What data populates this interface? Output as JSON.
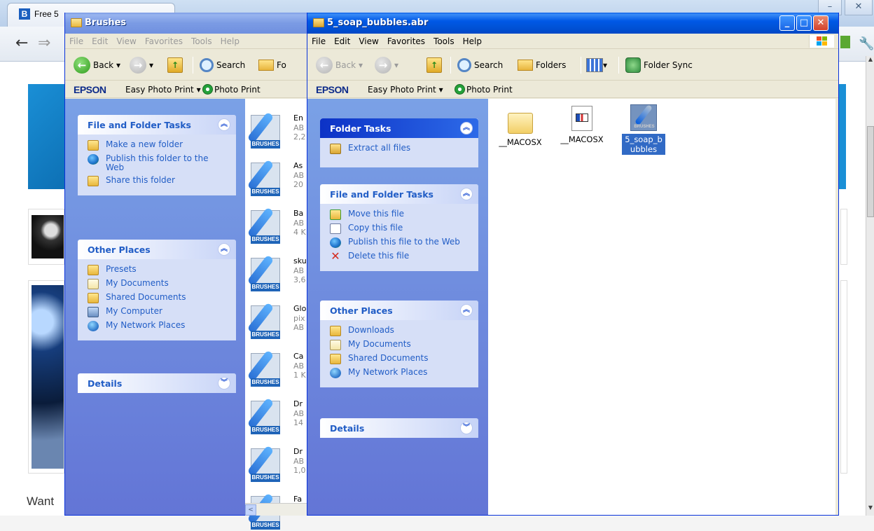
{
  "browser": {
    "tab_title": "Free 5",
    "tab_icon_letter": "B",
    "page_text_want": "Want",
    "win_min": "–",
    "win_close": "✕"
  },
  "brushes_window": {
    "title": "Brushes",
    "menu": [
      "File",
      "Edit",
      "View",
      "Favorites",
      "Tools",
      "Help"
    ],
    "toolbar": {
      "back": "Back",
      "search": "Search",
      "folders_partial": "Fo"
    },
    "epson": {
      "logo": "EPSON",
      "easy_photo": "Easy Photo Print ▾",
      "photo_print": "Photo Print"
    },
    "file_folder_tasks": {
      "title": "File and Folder Tasks",
      "items": [
        {
          "label": "Make a new folder",
          "icon": "folder-new-icon"
        },
        {
          "label": "Publish this folder to the Web",
          "icon": "globe-icon"
        },
        {
          "label": "Share this folder",
          "icon": "share-icon"
        }
      ]
    },
    "other_places": {
      "title": "Other Places",
      "items": [
        {
          "label": "Presets",
          "icon": "folder-icon"
        },
        {
          "label": "My Documents",
          "icon": "documents-icon"
        },
        {
          "label": "Shared Documents",
          "icon": "folder-icon"
        },
        {
          "label": "My Computer",
          "icon": "computer-icon"
        },
        {
          "label": "My Network Places",
          "icon": "network-icon"
        }
      ]
    },
    "details": {
      "title": "Details"
    },
    "brush_files": [
      {
        "name": "En",
        "type": "AB",
        "size": "2,2"
      },
      {
        "name": "As",
        "type": "AB",
        "size": "20"
      },
      {
        "name": "Ba",
        "type": "AB",
        "size": "4 K"
      },
      {
        "name": "sku",
        "type": "AB",
        "size": "3,6"
      },
      {
        "name": "Glo",
        "type": "pix",
        "size": "AB"
      },
      {
        "name": "Ca",
        "type": "AB",
        "size": "1 K"
      },
      {
        "name": "Dr",
        "type": "AB",
        "size": "14"
      },
      {
        "name": "Dr",
        "type": "AB",
        "size": "1,0"
      },
      {
        "name": "Fa",
        "type": "",
        "size": ""
      }
    ],
    "brushes_tag": "BRUSHES",
    "scroll_arrow": "<"
  },
  "soap_window": {
    "title": "5_soap_bubbles.abr",
    "menu": [
      "File",
      "Edit",
      "View",
      "Favorites",
      "Tools",
      "Help"
    ],
    "caption_buttons": {
      "minimize": "_",
      "maximize": "□",
      "close": "✕"
    },
    "toolbar": {
      "back": "Back",
      "search": "Search",
      "folders": "Folders",
      "folder_sync": "Folder Sync"
    },
    "epson": {
      "logo": "EPSON",
      "easy_photo": "Easy Photo Print ▾",
      "photo_print": "Photo Print"
    },
    "folder_tasks": {
      "title": "Folder Tasks",
      "items": [
        {
          "label": "Extract all files",
          "icon": "zip-icon"
        }
      ]
    },
    "file_folder_tasks": {
      "title": "File and Folder Tasks",
      "items": [
        {
          "label": "Move this file",
          "icon": "move-icon"
        },
        {
          "label": "Copy this file",
          "icon": "copy-icon"
        },
        {
          "label": "Publish this file to the Web",
          "icon": "globe-icon"
        },
        {
          "label": "Delete this file",
          "icon": "delete-icon"
        }
      ]
    },
    "other_places": {
      "title": "Other Places",
      "items": [
        {
          "label": "Downloads",
          "icon": "folder-icon"
        },
        {
          "label": "My Documents",
          "icon": "documents-icon"
        },
        {
          "label": "Shared Documents",
          "icon": "folder-icon"
        },
        {
          "label": "My Network Places",
          "icon": "network-icon"
        }
      ]
    },
    "details": {
      "title": "Details"
    },
    "files": [
      {
        "label": "__MACOSX",
        "kind": "folder",
        "selected": false
      },
      {
        "label": "__MACOSX",
        "kind": "document",
        "selected": false
      },
      {
        "label": "5_soap_bubbles",
        "kind": "brush",
        "selected": true
      }
    ],
    "brushes_tag": "BRUSHES"
  },
  "colors": {
    "xp_blue_title": "#0058e6",
    "sidepane_top": "#7aa1e6",
    "sidepane_bottom": "#6375d6",
    "link_blue": "#215dc6",
    "selection": "#316ac5"
  }
}
